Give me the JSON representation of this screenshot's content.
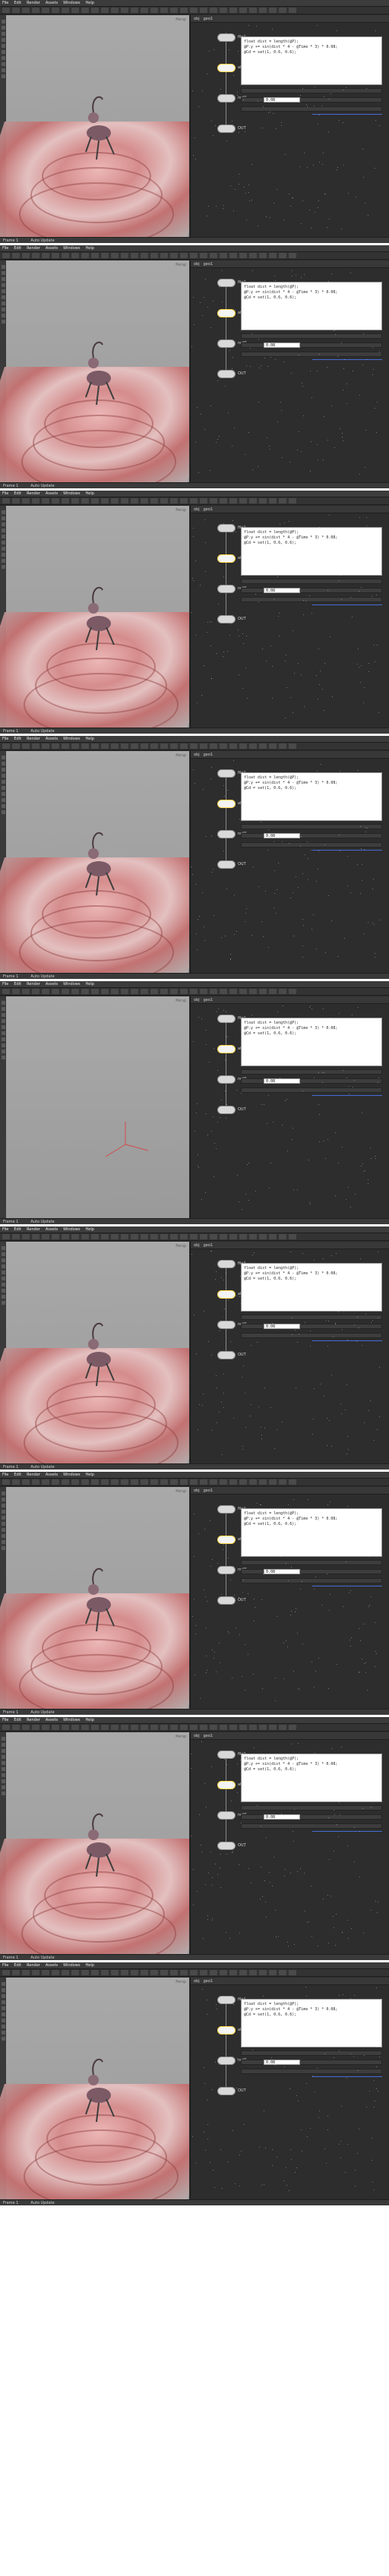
{
  "screenshot": {
    "frames_count": 9,
    "menubar": {
      "items": [
        "File",
        "Edit",
        "Render",
        "Assets",
        "Windows",
        "Help"
      ]
    },
    "viewport": {
      "label": "Persp"
    },
    "network": {
      "path": [
        "obj",
        "geo1"
      ],
      "node_labels": [
        "file1",
        "attribwrangle1",
        "null1",
        "OUT"
      ],
      "code_lines": [
        "float dist = length(@P);",
        "@P.y += sin(dist * 4 - @Time * 3) * 0.08;",
        "@Cd = set(1, 0.6, 0.6);"
      ],
      "param_value": "0.08"
    },
    "status_bar": {
      "left": "Frame 1",
      "right": "Auto Update"
    }
  },
  "colors": {
    "panel_bg": "#2d2d2d",
    "accent_blue": "#4c7cff",
    "selection_yellow": "#ffd94a",
    "ground_red": "#d88b8b"
  }
}
